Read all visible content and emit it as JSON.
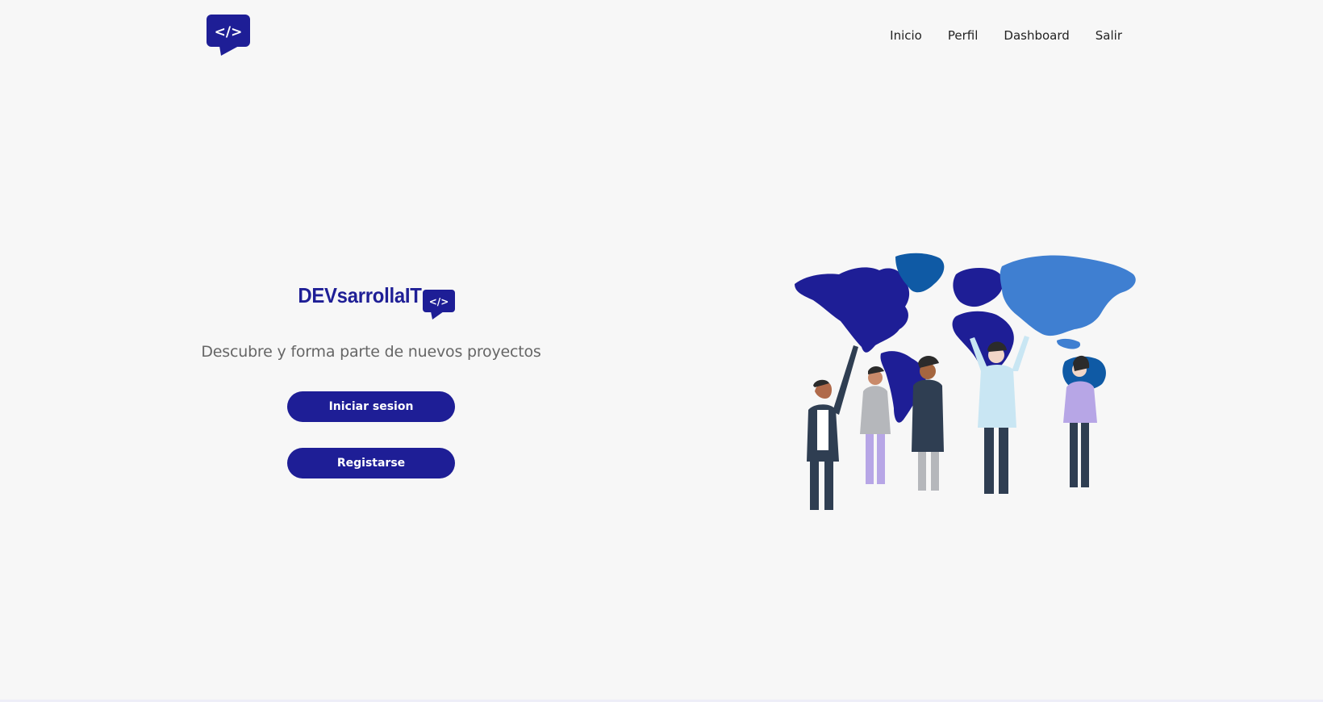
{
  "nav": {
    "items": [
      "Inicio",
      "Perfil",
      "Dashboard",
      "Salir"
    ]
  },
  "logo": {
    "icon": "code-chat-bubble-icon",
    "glyph": "</>"
  },
  "hero": {
    "brand": "DEVsarrollaIT",
    "tagline": "Descubre y forma parte de nuevos proyectos",
    "login_label": "Iniciar sesion",
    "register_label": "Registarse"
  },
  "illustration": {
    "name": "people-with-world-map-illustration"
  },
  "colors": {
    "brand": "#1e1e96",
    "background": "#f7f7f7",
    "map_light": "#3f7fd1",
    "map_mid": "#0f5aa5"
  }
}
